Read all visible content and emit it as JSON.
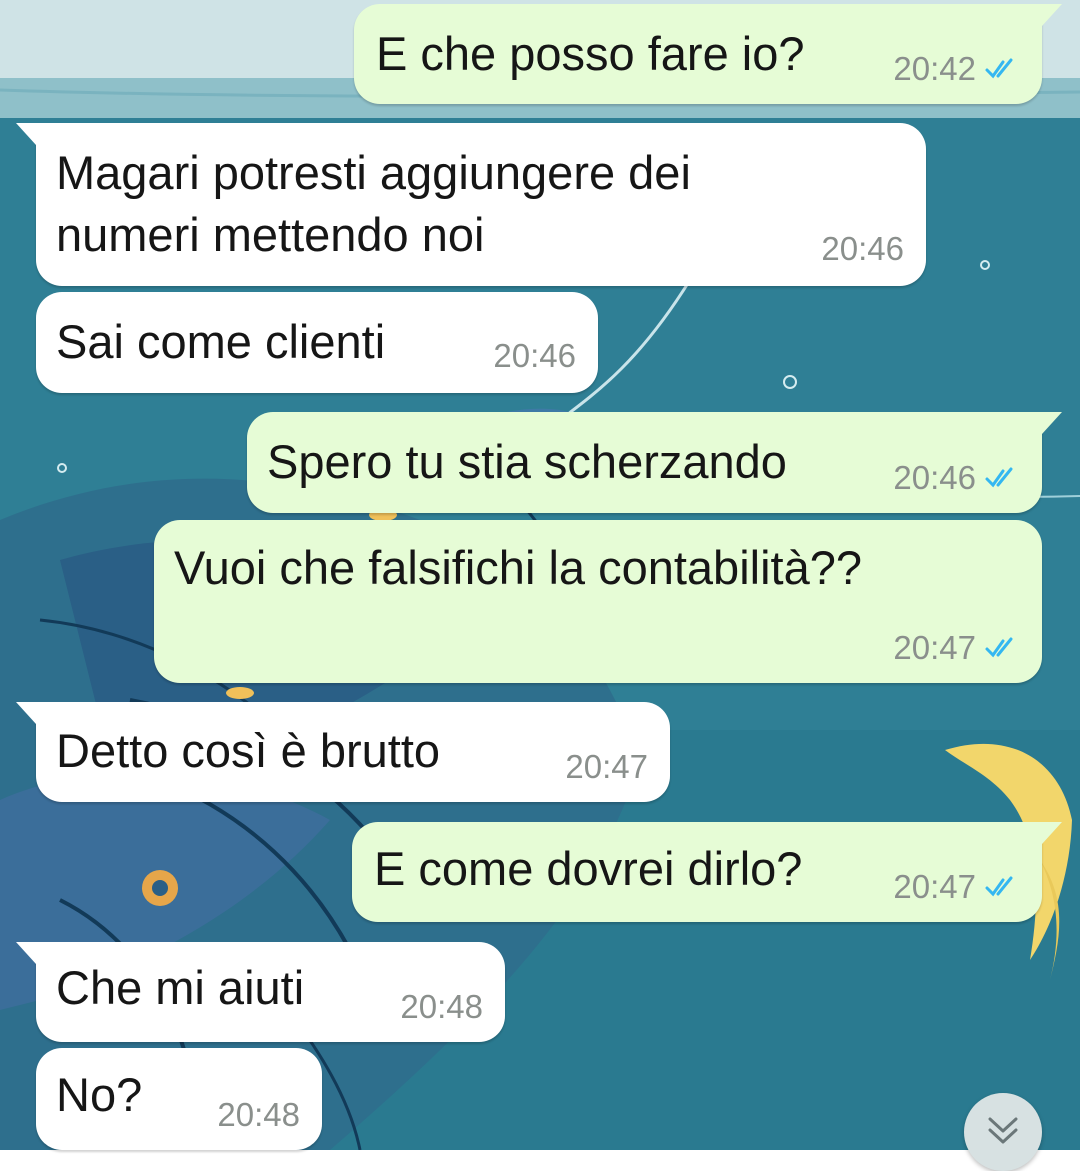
{
  "chat": {
    "messages": [
      {
        "direction": "out",
        "text": "E che posso fare io?",
        "time": "20:42",
        "status": "read"
      },
      {
        "direction": "in",
        "text": "Magari potresti aggiungere dei\nnumeri mettendo noi",
        "time": "20:46"
      },
      {
        "direction": "in",
        "text": "Sai come clienti",
        "time": "20:46"
      },
      {
        "direction": "out",
        "text": "Spero tu stia scherzando",
        "time": "20:46",
        "status": "read"
      },
      {
        "direction": "out",
        "text": "Vuoi che falsifichi la contabilità??",
        "time": "20:47",
        "status": "read"
      },
      {
        "direction": "in",
        "text": "Detto così è brutto",
        "time": "20:47"
      },
      {
        "direction": "out",
        "text": "E come dovrei dirlo?",
        "time": "20:47",
        "status": "read"
      },
      {
        "direction": "in",
        "text": "Che mi aiuti",
        "time": "20:48"
      },
      {
        "direction": "in",
        "text": "No?",
        "time": "20:48"
      }
    ],
    "scroll_down_icon": "double-chevron-down-icon"
  },
  "colors": {
    "outgoing_bubble": "#e6fcd6",
    "incoming_bubble": "#ffffff",
    "read_ticks": "#34b7f1",
    "wallpaper": "#2f7f95"
  }
}
